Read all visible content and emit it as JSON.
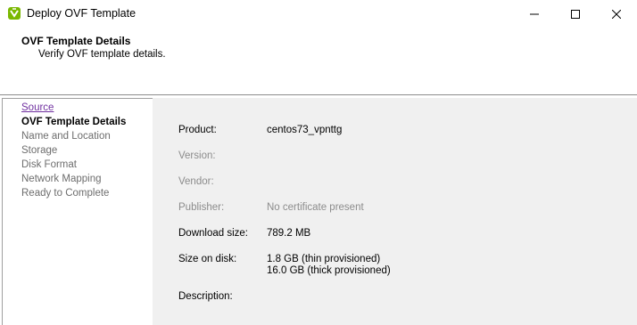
{
  "window": {
    "title": "Deploy OVF Template",
    "icon": "vsphere-logo-icon",
    "controls": [
      "minimize-icon",
      "maximize-icon",
      "close-icon"
    ]
  },
  "header": {
    "title": "OVF Template Details",
    "subtitle": "Verify OVF template details."
  },
  "nav": {
    "items": [
      {
        "label": "Source",
        "state": "visited-link"
      },
      {
        "label": "OVF Template Details",
        "state": "current"
      },
      {
        "label": "Name and Location",
        "state": "disabled"
      },
      {
        "label": "Storage",
        "state": "disabled"
      },
      {
        "label": "Disk Format",
        "state": "disabled"
      },
      {
        "label": "Network Mapping",
        "state": "disabled"
      },
      {
        "label": "Ready to Complete",
        "state": "disabled"
      }
    ]
  },
  "details": {
    "product": {
      "label": "Product:",
      "value": "centos73_vpnttg"
    },
    "version": {
      "label": "Version:",
      "value": ""
    },
    "vendor": {
      "label": "Vendor:",
      "value": ""
    },
    "publisher": {
      "label": "Publisher:",
      "value": "No certificate present"
    },
    "download_size": {
      "label": "Download size:",
      "value": "789.2 MB"
    },
    "size_on_disk": {
      "label": "Size on disk:",
      "value_thin": "1.8 GB (thin provisioned)",
      "value_thick": "16.0 GB (thick provisioned)"
    },
    "description": {
      "label": "Description:",
      "value": ""
    }
  },
  "colors": {
    "link_visited": "#7030a0",
    "disabled_text": "#6d6d6d",
    "content_bg": "#f0f0f0"
  }
}
